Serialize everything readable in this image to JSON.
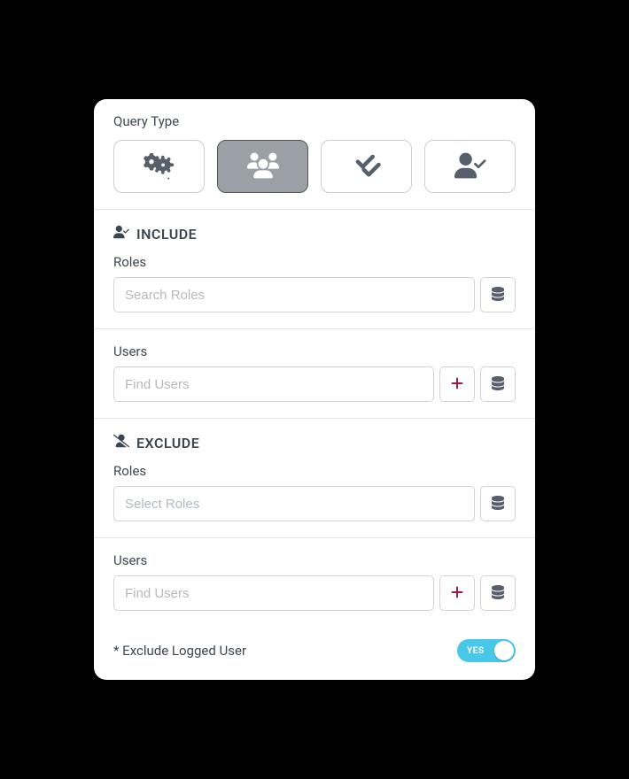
{
  "queryType": {
    "label": "Query Type",
    "options": [
      "settings",
      "users-group",
      "double-check",
      "user-check"
    ],
    "activeIndex": 1
  },
  "include": {
    "heading": "INCLUDE",
    "roles": {
      "label": "Roles",
      "placeholder": "Search Roles"
    },
    "users": {
      "label": "Users",
      "placeholder": "Find Users"
    }
  },
  "exclude": {
    "heading": "EXCLUDE",
    "roles": {
      "label": "Roles",
      "placeholder": "Select Roles"
    },
    "users": {
      "label": "Users",
      "placeholder": "Find Users"
    }
  },
  "footer": {
    "label": "* Exclude Logged User",
    "toggle": {
      "on": true,
      "onLabel": "YES"
    }
  }
}
